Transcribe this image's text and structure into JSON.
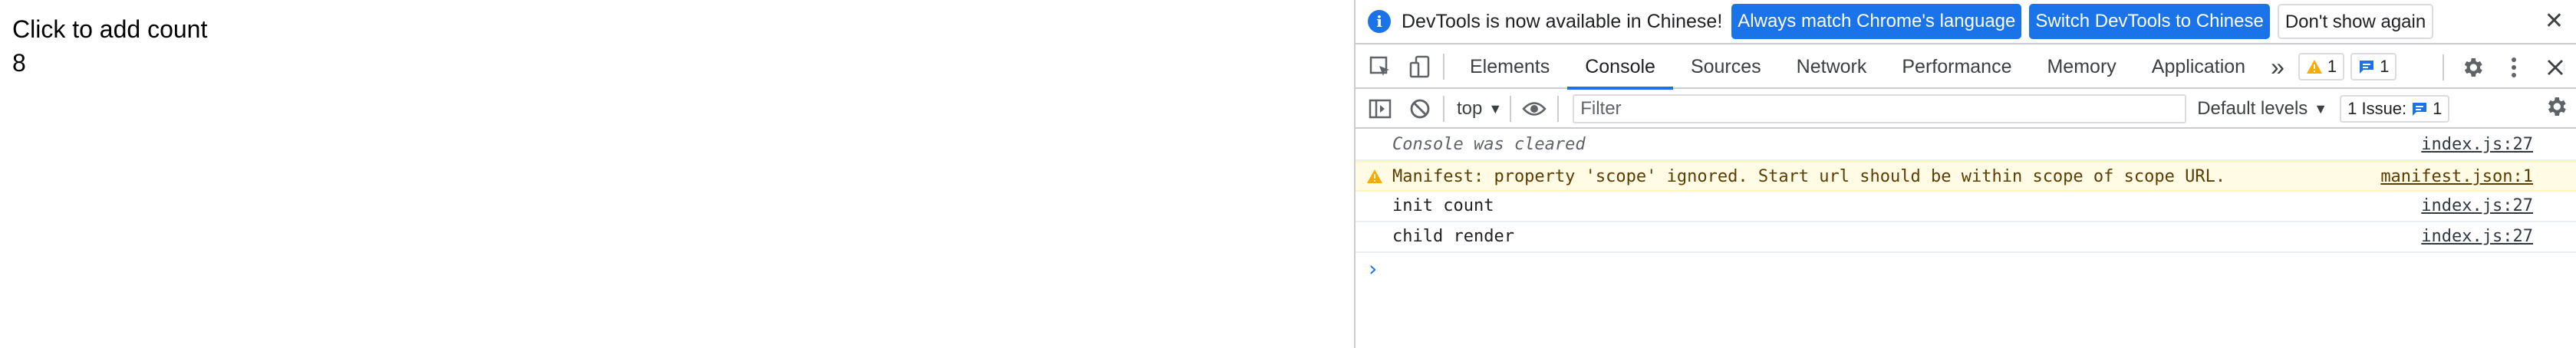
{
  "page": {
    "line1": "Click to add count",
    "line2": "8"
  },
  "infobar": {
    "message": "DevTools is now available in Chinese!",
    "btn_match": "Always match Chrome's language",
    "btn_switch": "Switch DevTools to Chinese",
    "btn_dismiss": "Don't show again"
  },
  "tabs": [
    {
      "label": "Elements"
    },
    {
      "label": "Console"
    },
    {
      "label": "Sources"
    },
    {
      "label": "Network"
    },
    {
      "label": "Performance"
    },
    {
      "label": "Memory"
    },
    {
      "label": "Application"
    }
  ],
  "badges": {
    "warnings": "1",
    "messages": "1"
  },
  "console_toolbar": {
    "context": "top",
    "filter_placeholder": "Filter",
    "levels": "Default levels",
    "issues_label": "1 Issue:",
    "issues_count": "1"
  },
  "logs": [
    {
      "text": "Console was cleared",
      "source": "index.js:27",
      "kind": "info"
    },
    {
      "text": "Manifest: property 'scope' ignored. Start url should be within scope of scope URL.",
      "source": "manifest.json:1",
      "kind": "warning"
    },
    {
      "text": "init count",
      "source": "index.js:27",
      "kind": "log"
    },
    {
      "text": "child render",
      "source": "index.js:27",
      "kind": "log"
    }
  ],
  "colors": {
    "accent": "#1a73e8",
    "warning_bg": "#fffbe5",
    "warning_icon": "#f9ab00"
  }
}
